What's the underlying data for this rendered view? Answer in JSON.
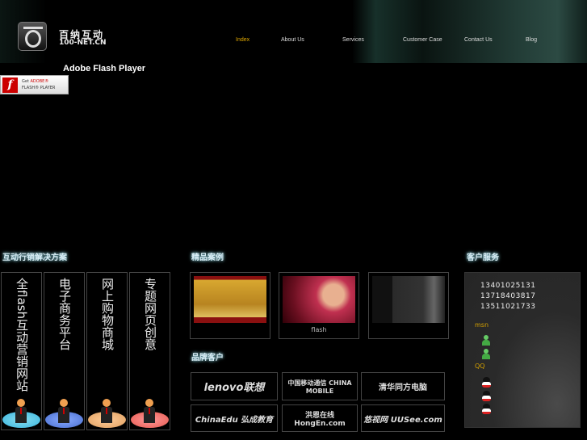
{
  "header": {
    "brand_cn": "百纳互动",
    "brand_en": "100-NET.CN",
    "nav": [
      {
        "label": "Index",
        "active": true
      },
      {
        "label": "About Us"
      },
      {
        "label": "Services"
      },
      {
        "label": "Customer Case"
      },
      {
        "label": "Contact Us"
      },
      {
        "label": "Blog"
      }
    ]
  },
  "flash": {
    "title": "Adobe Flash Player",
    "badge_get": "Get",
    "badge_adobe": "ADOBE®",
    "badge_player": "FLASH® PLAYER"
  },
  "solutions": {
    "title": "互动行销解决方案",
    "items": [
      {
        "label": "全flash互动营销网站",
        "color": "#3ab6e0"
      },
      {
        "label": "电子商务平台",
        "color": "#4a6fd0"
      },
      {
        "label": "网上购物商城",
        "color": "#e0a060"
      },
      {
        "label": "专题网页创意",
        "color": "#e85a50"
      }
    ]
  },
  "cases": {
    "title": "精品案例",
    "items": [
      {
        "caption": ""
      },
      {
        "caption": "flash"
      },
      {
        "caption": ""
      }
    ]
  },
  "brands": {
    "title": "品牌客户",
    "items": [
      "lenovo联想",
      "中国移动通信 CHINA MOBILE",
      "清华同方电脑",
      "ChinaEdu 弘成教育",
      "洪恩在线 HongEn.com",
      "悠视网 UUSee.com"
    ]
  },
  "service": {
    "title": "客户服务",
    "phones": [
      "13401025131",
      "13718403817",
      "13511021733"
    ],
    "msn_label": "msn",
    "qq_label": "QQ"
  },
  "colors": {
    "accent": "#e0a800",
    "title_glow": "#d8ecf4"
  }
}
